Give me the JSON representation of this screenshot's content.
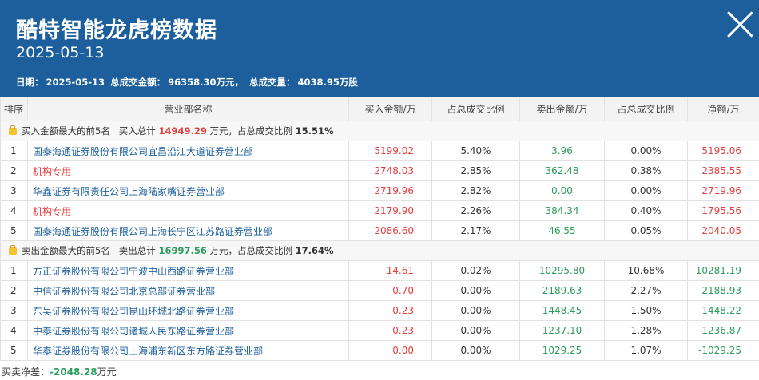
{
  "header": {
    "title": "酷特智能龙虎榜数据",
    "date": "2025-05-13",
    "summary": {
      "date_label": "日期：",
      "date_value": "2025-05-13",
      "amount_label": "总成交金额：",
      "amount_value": "96358.30万元，",
      "volume_label": "总成交量：",
      "volume_value": "4038.95万股"
    }
  },
  "table": {
    "headers": [
      "排序",
      "营业部名称",
      "买入金额/万",
      "占总成交比例",
      "卖出金额/万",
      "占总成交比例",
      "净额/万"
    ],
    "buy_section": {
      "label": "买入金额最大的前5名",
      "total_label": "买入总计",
      "total_value": "14949.29",
      "unit": "万元，占总成交比例",
      "ratio": "15.51%"
    },
    "buy_rows": [
      {
        "idx": "1",
        "name": "国泰海通证券股份有限公司宜昌沿江大道证券营业部",
        "buy": "5199.02",
        "buy_pct": "5.40%",
        "sell": "3.96",
        "sell_pct": "0.00%",
        "net": "5195.06"
      },
      {
        "idx": "2",
        "name": "机构专用",
        "buy": "2748.03",
        "buy_pct": "2.85%",
        "sell": "362.48",
        "sell_pct": "0.38%",
        "net": "2385.55"
      },
      {
        "idx": "3",
        "name": "华鑫证券有限责任公司上海陆家嘴证券营业部",
        "buy": "2719.96",
        "buy_pct": "2.82%",
        "sell": "0.00",
        "sell_pct": "0.00%",
        "net": "2719.96"
      },
      {
        "idx": "4",
        "name": "机构专用",
        "buy": "2179.90",
        "buy_pct": "2.26%",
        "sell": "384.34",
        "sell_pct": "0.40%",
        "net": "1795.56"
      },
      {
        "idx": "5",
        "name": "国泰海通证券股份有限公司上海长宁区江苏路证券营业部",
        "buy": "2086.60",
        "buy_pct": "2.17%",
        "sell": "46.55",
        "sell_pct": "0.05%",
        "net": "2040.05"
      }
    ],
    "sell_section": {
      "label": "卖出金额最大的前5名",
      "total_label": "卖出总计",
      "total_value": "16997.56",
      "unit": "万元，占总成交比例",
      "ratio": "17.64%"
    },
    "sell_rows": [
      {
        "idx": "1",
        "name": "方正证券股份有限公司宁波中山西路证券营业部",
        "buy": "14.61",
        "buy_pct": "0.02%",
        "sell": "10295.80",
        "sell_pct": "10.68%",
        "net": "-10281.19"
      },
      {
        "idx": "2",
        "name": "中信证券股份有限公司北京总部证券营业部",
        "buy": "0.70",
        "buy_pct": "0.00%",
        "sell": "2189.63",
        "sell_pct": "2.27%",
        "net": "-2188.93"
      },
      {
        "idx": "3",
        "name": "东吴证券股份有限公司昆山环城北路证券营业部",
        "buy": "0.23",
        "buy_pct": "0.00%",
        "sell": "1448.45",
        "sell_pct": "1.50%",
        "net": "-1448.22"
      },
      {
        "idx": "4",
        "name": "中泰证券股份有限公司诸城人民东路证券营业部",
        "buy": "0.23",
        "buy_pct": "0.00%",
        "sell": "1237.10",
        "sell_pct": "1.28%",
        "net": "-1236.87"
      },
      {
        "idx": "5",
        "name": "华泰证券股份有限公司上海浦东新区东方路证券营业部",
        "buy": "0.00",
        "buy_pct": "0.00%",
        "sell": "1029.25",
        "sell_pct": "1.07%",
        "net": "-1029.25"
      }
    ]
  },
  "footer": {
    "label": "买卖净差：",
    "value": "-2048.28",
    "unit": "万元"
  },
  "colors": {
    "header_bg": "#1c5f9c",
    "buy_red": "#e33e3e",
    "sell_green": "#2a9c5c",
    "link_blue": "#1c5f9c"
  }
}
